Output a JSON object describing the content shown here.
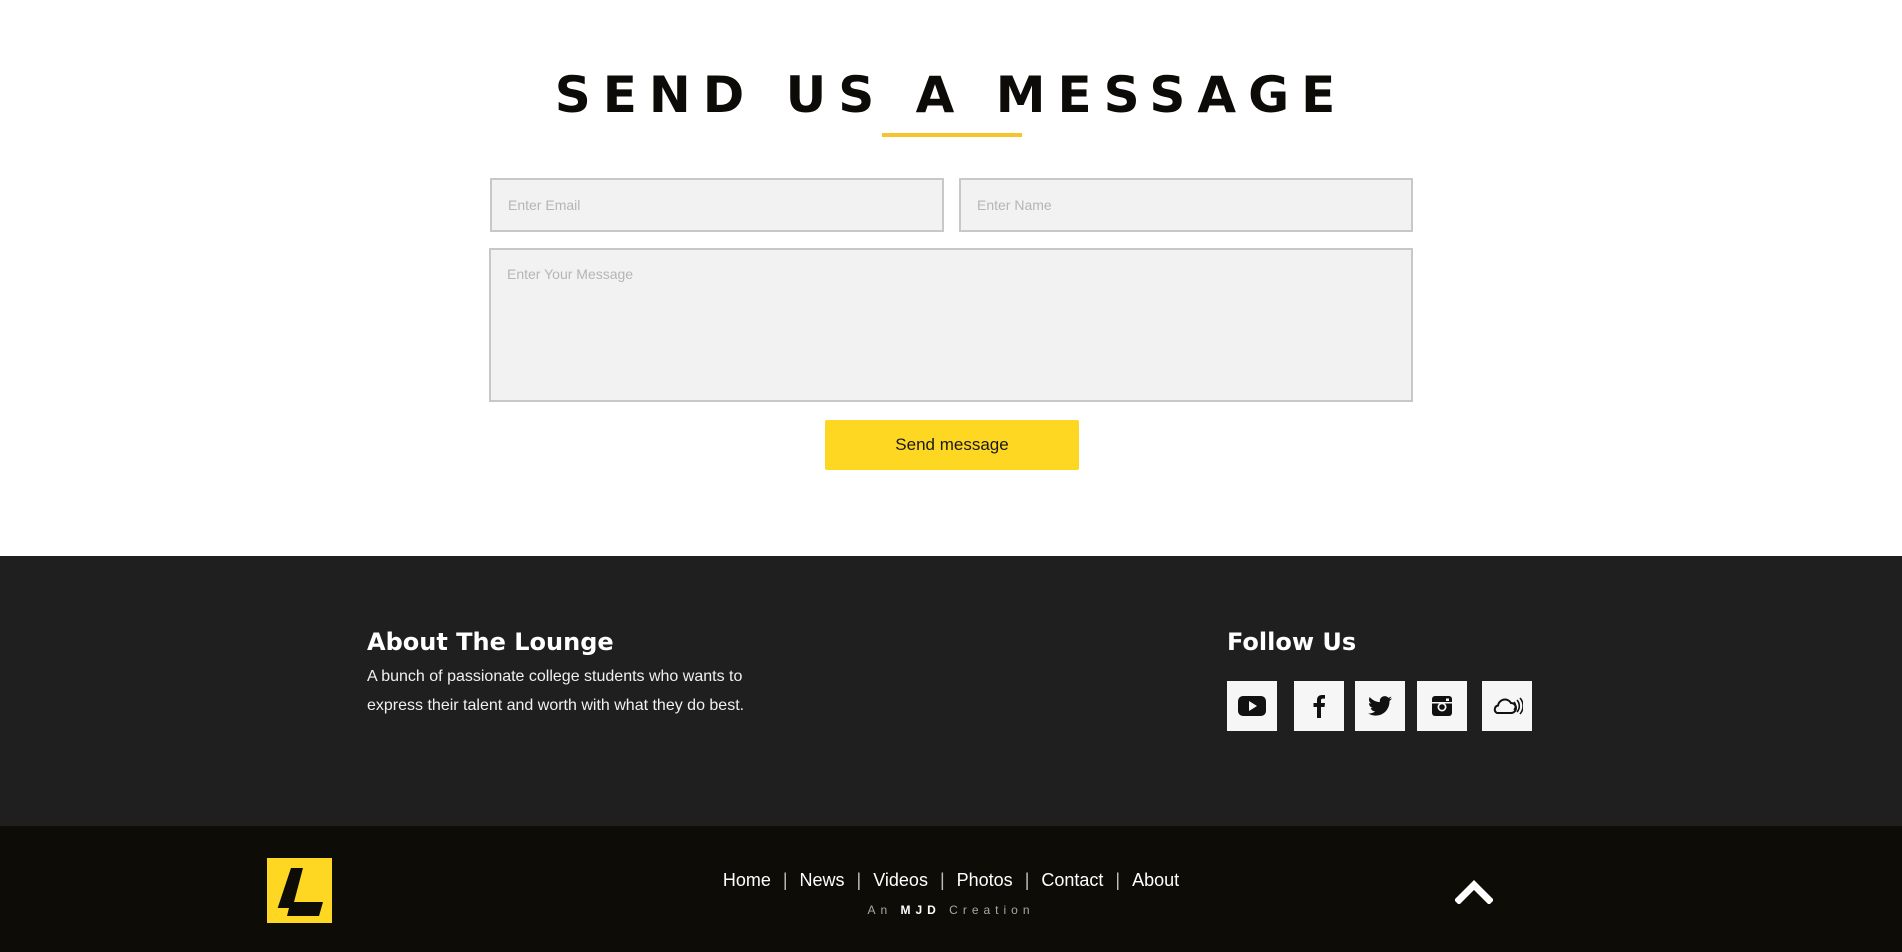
{
  "contact": {
    "title": "SEND US A MESSAGE",
    "email_placeholder": "Enter Email",
    "name_placeholder": "Enter Name",
    "message_placeholder": "Enter Your Message",
    "send_label": "Send message"
  },
  "about": {
    "heading": "About The Lounge",
    "text": "A bunch of passionate college students who wants to express their talent and worth with what they do best."
  },
  "follow": {
    "heading": "Follow Us",
    "icons": [
      "youtube-icon",
      "facebook-icon",
      "twitter-icon",
      "instagram-icon",
      "soundcloud-icon"
    ]
  },
  "footer": {
    "nav": [
      "Home",
      "News",
      "Videos",
      "Photos",
      "Contact",
      "About"
    ],
    "separator": "|",
    "credit_prefix": "An",
    "credit_brand": "MJD",
    "credit_suffix": "Creation"
  },
  "colors": {
    "accent": "#fdd721",
    "underline": "#f6c42b",
    "info_bg": "#1f1f1f",
    "bottom_bg": "#0d0c07"
  }
}
